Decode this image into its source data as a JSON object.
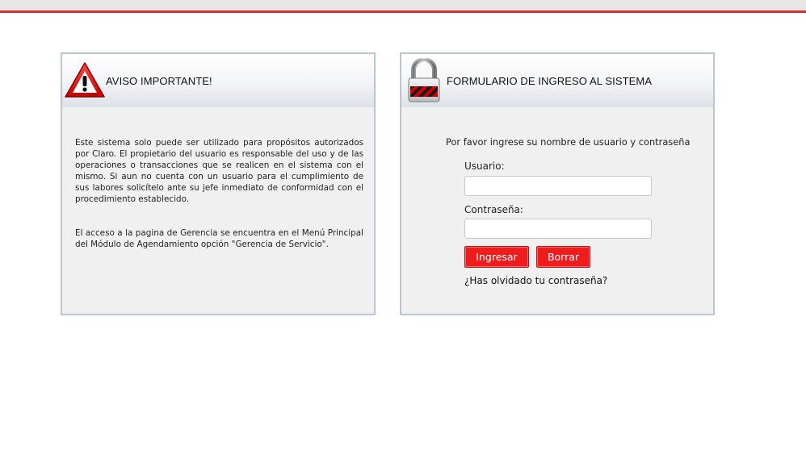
{
  "notice": {
    "title": "AVISO IMPORTANTE!",
    "icon": "warning-icon",
    "paragraph1": "Este sistema solo puede ser utilizado para propósitos autorizados por Claro. El propietario del usuario es responsable del uso y de las operaciones o transacciones que se realicen en el sistema con el mismo. Si aun no cuenta con un usuario para el cumplimiento de sus labores solicítelo ante su jefe inmediato de conformidad con el procedimiento establecido.",
    "paragraph2": "El acceso a la pagina de Gerencia se encuentra en el Menú Principal del Módulo de Agendamiento opción \"Gerencia de Servicio\"."
  },
  "login": {
    "title": "FORMULARIO DE INGRESO AL SISTEMA",
    "icon": "lock-icon",
    "prompt": "Por favor ingrese su nombre de usuario y contraseña",
    "username_label": "Usuario:",
    "username_value": "",
    "password_label": "Contraseña:",
    "password_value": "",
    "submit_label": "Ingresar",
    "clear_label": "Borrar",
    "forgot_label": "¿Has olvidado tu contraseña?"
  },
  "colors": {
    "accent_red": "#ee1c1c",
    "top_border": "#d32f2f",
    "panel_border": "#b9c6d6",
    "panel_bg": "#f0f0f0"
  }
}
